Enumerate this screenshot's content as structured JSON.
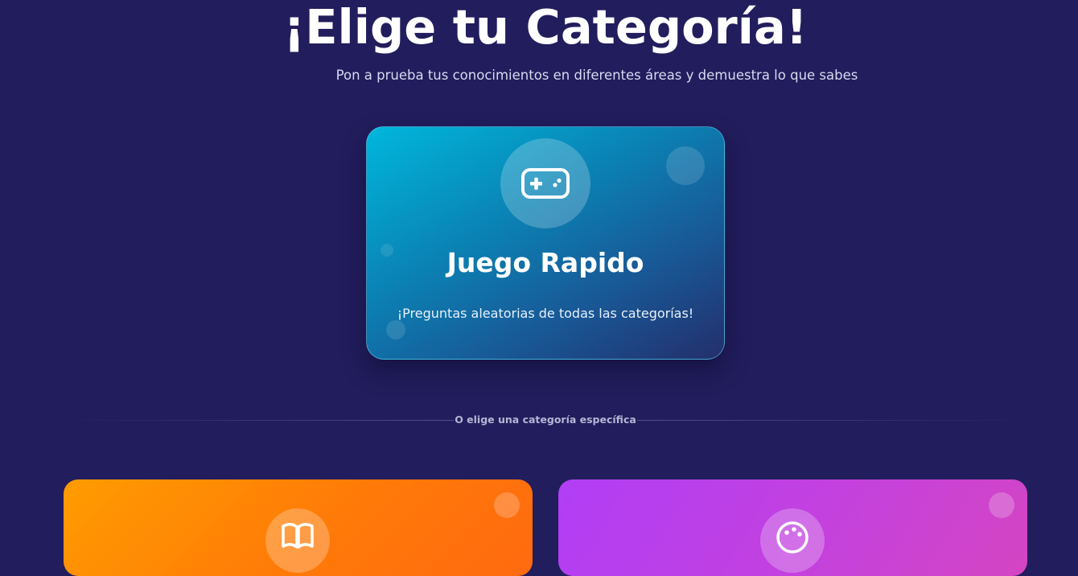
{
  "header": {
    "title": "¡Elige tu Categoría!",
    "subtitle": "Pon a prueba tus conocimientos en diferentes áreas y demuestra lo que sabes"
  },
  "quick_play": {
    "title": "Juego Rapido",
    "description": "¡Preguntas aleatorias de todas las categorías!",
    "icon": "gamepad-icon",
    "gradient": [
      "#00b7dc",
      "#0a84b5",
      "#185a98",
      "#232f6c"
    ]
  },
  "divider": {
    "label": "O elige una categoría específica"
  },
  "categories": [
    {
      "icon": "book-icon",
      "color": "#ff8a00"
    },
    {
      "icon": "palette-icon",
      "color": "#bf3fe6"
    }
  ],
  "colors": {
    "background": "#221d5c",
    "text": "#ffffff",
    "muted_text": "#d8d9f0"
  }
}
